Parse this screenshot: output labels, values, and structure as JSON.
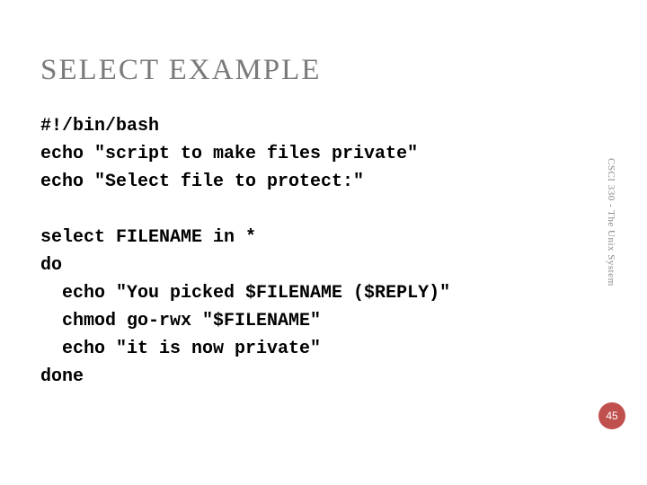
{
  "title": "SELECT EXAMPLE",
  "code": {
    "l1": "#!/bin/bash",
    "l2": "echo \"script to make files private\"",
    "l3": "echo \"Select file to protect:\"",
    "l4": "",
    "l5": "select FILENAME in *",
    "l6": "do",
    "l7": "  echo \"You picked $FILENAME ($REPLY)\"",
    "l8": "  chmod go-rwx \"$FILENAME\"",
    "l9": "  echo \"it is now private\"",
    "l10": "done"
  },
  "sidetext": "CSCI 330 - The Unix System",
  "pagenum": "45"
}
